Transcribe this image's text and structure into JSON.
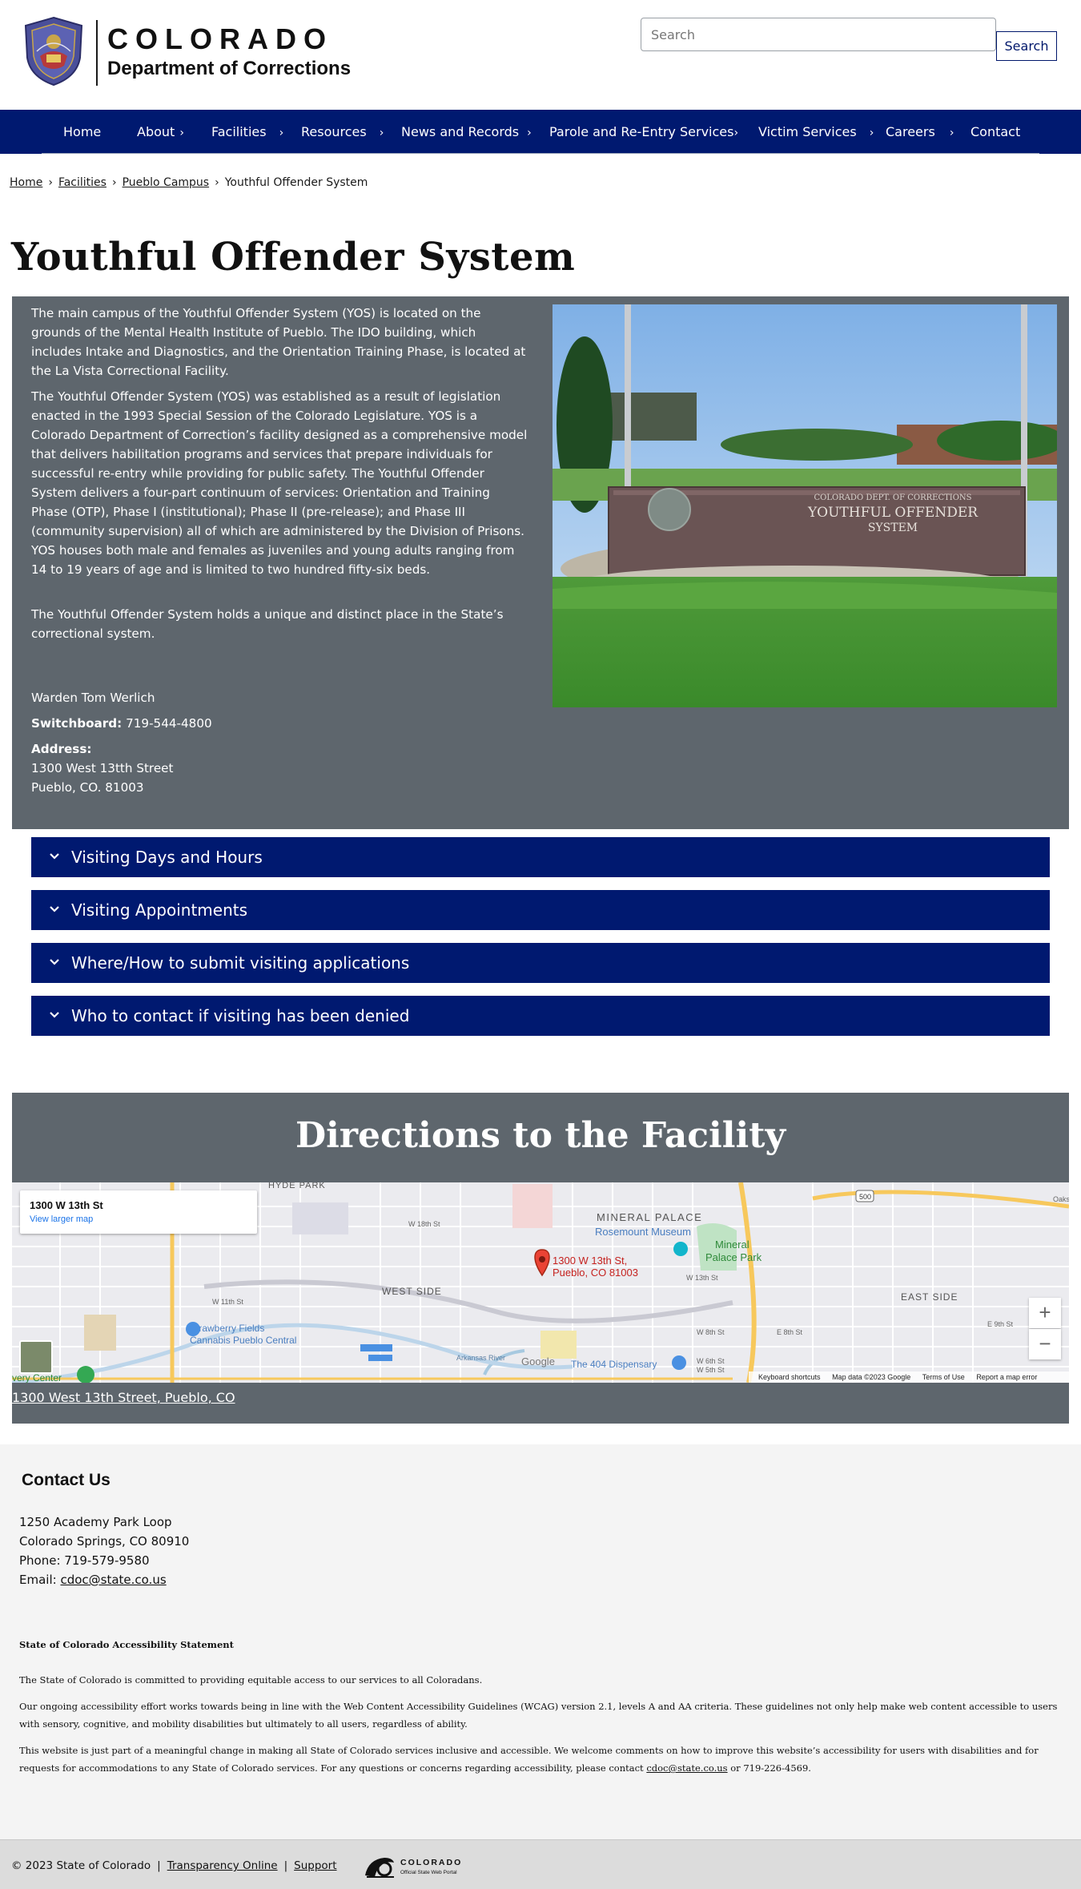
{
  "header": {
    "state_name": "COLORADO",
    "department": "Department of Corrections",
    "search_placeholder": "Search",
    "search_button": "Search"
  },
  "nav": {
    "items": [
      {
        "label": "Home",
        "chevron": ""
      },
      {
        "label": "About",
        "chevron": "›"
      },
      {
        "label": "Facilities",
        "chevron": "›"
      },
      {
        "label": "Resources",
        "chevron": "›"
      },
      {
        "label": "News and Records",
        "chevron": "›"
      },
      {
        "label": "Parole and Re-Entry Services",
        "chevron": "›"
      },
      {
        "label": "Victim Services",
        "chevron": "›"
      },
      {
        "label": "Careers",
        "chevron": "›"
      },
      {
        "label": "Contact",
        "chevron": ""
      }
    ]
  },
  "breadcrumb": {
    "items": [
      "Home",
      "Facilities",
      "Pueblo Campus",
      "Youthful Offender System"
    ],
    "separator": "›"
  },
  "page": {
    "title": "Youthful Offender System"
  },
  "info": {
    "p1": "The main campus of the Youthful Offender System (YOS) is located on the grounds of the Mental Health Institute of Pueblo.  The IDO building, which includes Intake and Diagnostics, and the Orientation Training Phase, is located at the La Vista Correctional Facility.",
    "p2": "The Youthful Offender System (YOS) was established as a result of legislation enacted in the 1993 Special Session of the Colorado Legislature.  YOS is a Colorado Department of Correction’s facility designed as a comprehensive model that delivers habilitation programs and services that prepare individuals for successful re-entry while providing for public safety.  The Youthful Offender System delivers a four-part continuum of services:  Orientation and Training Phase (OTP), Phase I (institutional); Phase II (pre-release); and Phase III (community supervision) all of which are administered by the Division of Prisons. YOS houses both male and females as juveniles and young adults ranging from 14 to 19 years of age and is limited to two hundred fifty-six beds.",
    "p3": "The Youthful Offender System holds a unique and distinct place in the State’s correctional system.",
    "warden": "Warden Tom Werlich",
    "switchboard_label": "Switchboard:",
    "switchboard_value": "719-544-4800",
    "address_label": "Address:",
    "address_line1": "1300 West 13tth Street",
    "address_line2": "Pueblo, CO. 81003"
  },
  "photo": {
    "sign_line1": "COLORADO DEPT. OF CORRECTIONS",
    "sign_line2": "YOUTHFUL OFFENDER",
    "sign_line3": "SYSTEM"
  },
  "accordions": [
    {
      "label": "Visiting Days and Hours"
    },
    {
      "label": "Visiting Appointments"
    },
    {
      "label": "Where/How to submit visiting applications"
    },
    {
      "label": "Who to contact if visiting has been denied"
    }
  ],
  "directions": {
    "title": "Directions to the Facility",
    "map_card_title": "1300 W 13th St",
    "map_card_link": "View larger map",
    "pin_label_1": "1300 W 13th St,",
    "pin_label_2": "Pueblo, CO 81003",
    "zoom_in": "+",
    "zoom_out": "−",
    "map_labels": {
      "hyde_park": "HYDE PARK",
      "mineral_palace": "MINERAL PALACE",
      "rosemount": "Rosemount Museum",
      "mineral_park_1": "Mineral",
      "mineral_park_2": "Palace Park",
      "west_side": "WEST SIDE",
      "east_side": "EAST SIDE",
      "strawberry_1": "Strawberry Fields",
      "strawberry_2": "Cannabis Pueblo Central",
      "dispensary": "The 404 Dispensary",
      "google": "Google",
      "very_center": "very Center",
      "st_w18": "W 18th St",
      "st_w11": "W 11th St",
      "st_w13": "W 13th St",
      "st_w8": "W 8th St",
      "st_w6": "W 6th St",
      "st_w5": "W 5th St",
      "st_e8": "E 8th St",
      "st_e9": "E 9th St",
      "hwy": "500",
      "oaks": "Oaks",
      "arkansas": "Arkansas River"
    },
    "attr": {
      "shortcuts": "Keyboard shortcuts",
      "data": "Map data ©2023 Google",
      "terms": "Terms of Use",
      "report": "Report a map error"
    },
    "address_link": "1300 West 13th Street, Pueblo, CO"
  },
  "footer": {
    "contact_title": "Contact Us",
    "line1": "1250 Academy Park Loop",
    "line2": "Colorado Springs, CO 80910",
    "line3": "Phone: 719-579-9580",
    "email_label": "Email:",
    "email": "cdoc@state.co.us",
    "a11y_title": "State of Colorado Accessibility Statement",
    "a11y_p1": "The State of Colorado is committed to providing equitable access to our services to all Coloradans.",
    "a11y_p2": "Our ongoing accessibility effort works towards being in line with the Web Content Accessibility Guidelines (WCAG) version 2.1, levels A and AA criteria. These guidelines not only help make web content accessible to users with sensory, cognitive, and mobility disabilities but ultimately to all users, regardless of ability.",
    "a11y_p3_pre": "This website is just part of a meaningful change in making all State of Colorado services inclusive and accessible. We welcome comments on how to improve this website’s accessibility for users with disabilities and for requests for accommodations to any State of Colorado services. For any questions or concerns regarding accessibility, please contact ",
    "a11y_p3_email": "cdoc@state.co.us",
    "a11y_p3_post": " or 719-226-4569.",
    "copyright": "© 2023 State of Colorado",
    "link_transparency": "Transparency Online",
    "link_support": "Support",
    "pipe": "|",
    "portal_name": "COLORADO",
    "portal_sub": "Official State Web Portal"
  },
  "colors": {
    "nav_blue": "#001970",
    "panel_gray": "#5e666d",
    "footer_bg": "#f4f4f4"
  }
}
